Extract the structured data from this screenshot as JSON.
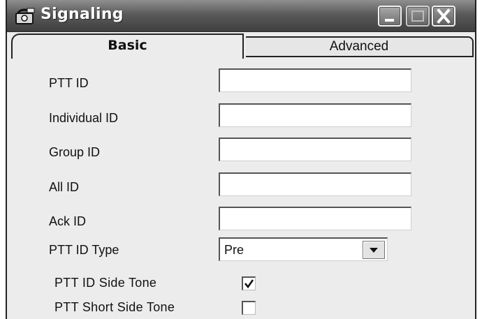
{
  "window": {
    "title": "Signaling",
    "app_icon": "phone-icon",
    "controls": {
      "minimize_icon": "minimize-icon",
      "maximize_icon": "maximize-icon",
      "close_icon": "close-icon"
    }
  },
  "tabs": [
    {
      "label": "Basic",
      "active": true
    },
    {
      "label": "Advanced",
      "active": false
    }
  ],
  "fields": [
    {
      "label": "PTT ID",
      "value": ""
    },
    {
      "label": "Individual ID",
      "value": ""
    },
    {
      "label": "Group ID",
      "value": ""
    },
    {
      "label": "All ID",
      "value": ""
    },
    {
      "label": "Ack ID",
      "value": ""
    }
  ],
  "ptt_id_type": {
    "label": "PTT ID Type",
    "value": "Pre"
  },
  "checkboxes": [
    {
      "label": "PTT ID Side Tone",
      "checked": true
    },
    {
      "label": "PTT Short Side Tone",
      "checked": false
    }
  ]
}
